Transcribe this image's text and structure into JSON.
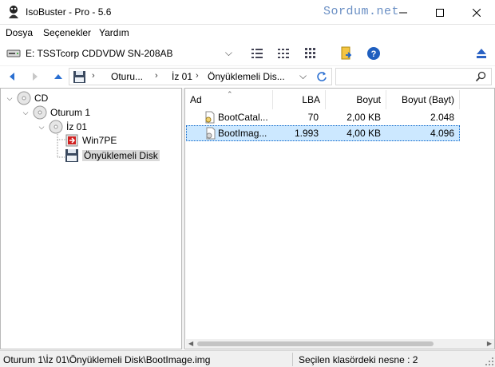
{
  "window": {
    "title": "IsoBuster - Pro - 5.6",
    "watermark": "Sordum.net",
    "minimize_icon": "minimize-icon",
    "maximize_icon": "maximize-icon",
    "close_icon": "close-icon"
  },
  "menu": {
    "items": [
      "Dosya",
      "Seçenekler",
      "Yardım"
    ]
  },
  "toolbar": {
    "drive": "E: TSSTcorp CDDVDW SN-208AB",
    "icons": [
      "list-view-icon",
      "detail-view-icon",
      "grid-view-icon",
      "export-icon",
      "help-icon",
      "eject-icon"
    ]
  },
  "nav": {
    "crumbs": [
      "Oturu...",
      "İz 01",
      "Önyüklemeli Dis..."
    ],
    "search_placeholder": ""
  },
  "tree": {
    "nodes": [
      {
        "label": "CD",
        "icon": "cd-icon",
        "toggle": "expanded"
      },
      {
        "label": "Oturum 1",
        "icon": "session-icon",
        "toggle": "expanded"
      },
      {
        "label": "İz 01",
        "icon": "track-icon",
        "toggle": "expanded"
      },
      {
        "label": "Win7PE",
        "icon": "iso-folder-icon",
        "toggle": ""
      },
      {
        "label": "Önyüklemeli Disk",
        "icon": "bootable-disk-icon",
        "toggle": "",
        "selected": true
      }
    ]
  },
  "list": {
    "columns": [
      "Ad",
      "LBA",
      "Boyut",
      "Boyut (Bayt)"
    ],
    "rows": [
      {
        "name": "BootCatal...",
        "lba": "70",
        "size": "2,00 KB",
        "bytes": "2.048",
        "icon": "catalog-file-icon"
      },
      {
        "name": "BootImag...",
        "lba": "1.993",
        "size": "4,00 KB",
        "bytes": "4.096",
        "icon": "image-file-icon",
        "selected": true
      }
    ]
  },
  "status": {
    "path": "Oturum 1\\İz 01\\Önyüklemeli Disk\\BootImage.img",
    "count": "Seçilen klasördeki nesne : 2"
  },
  "colors": {
    "selection": "#cce8ff",
    "accent": "#0078d7",
    "watermark": "#6a8fc4"
  }
}
